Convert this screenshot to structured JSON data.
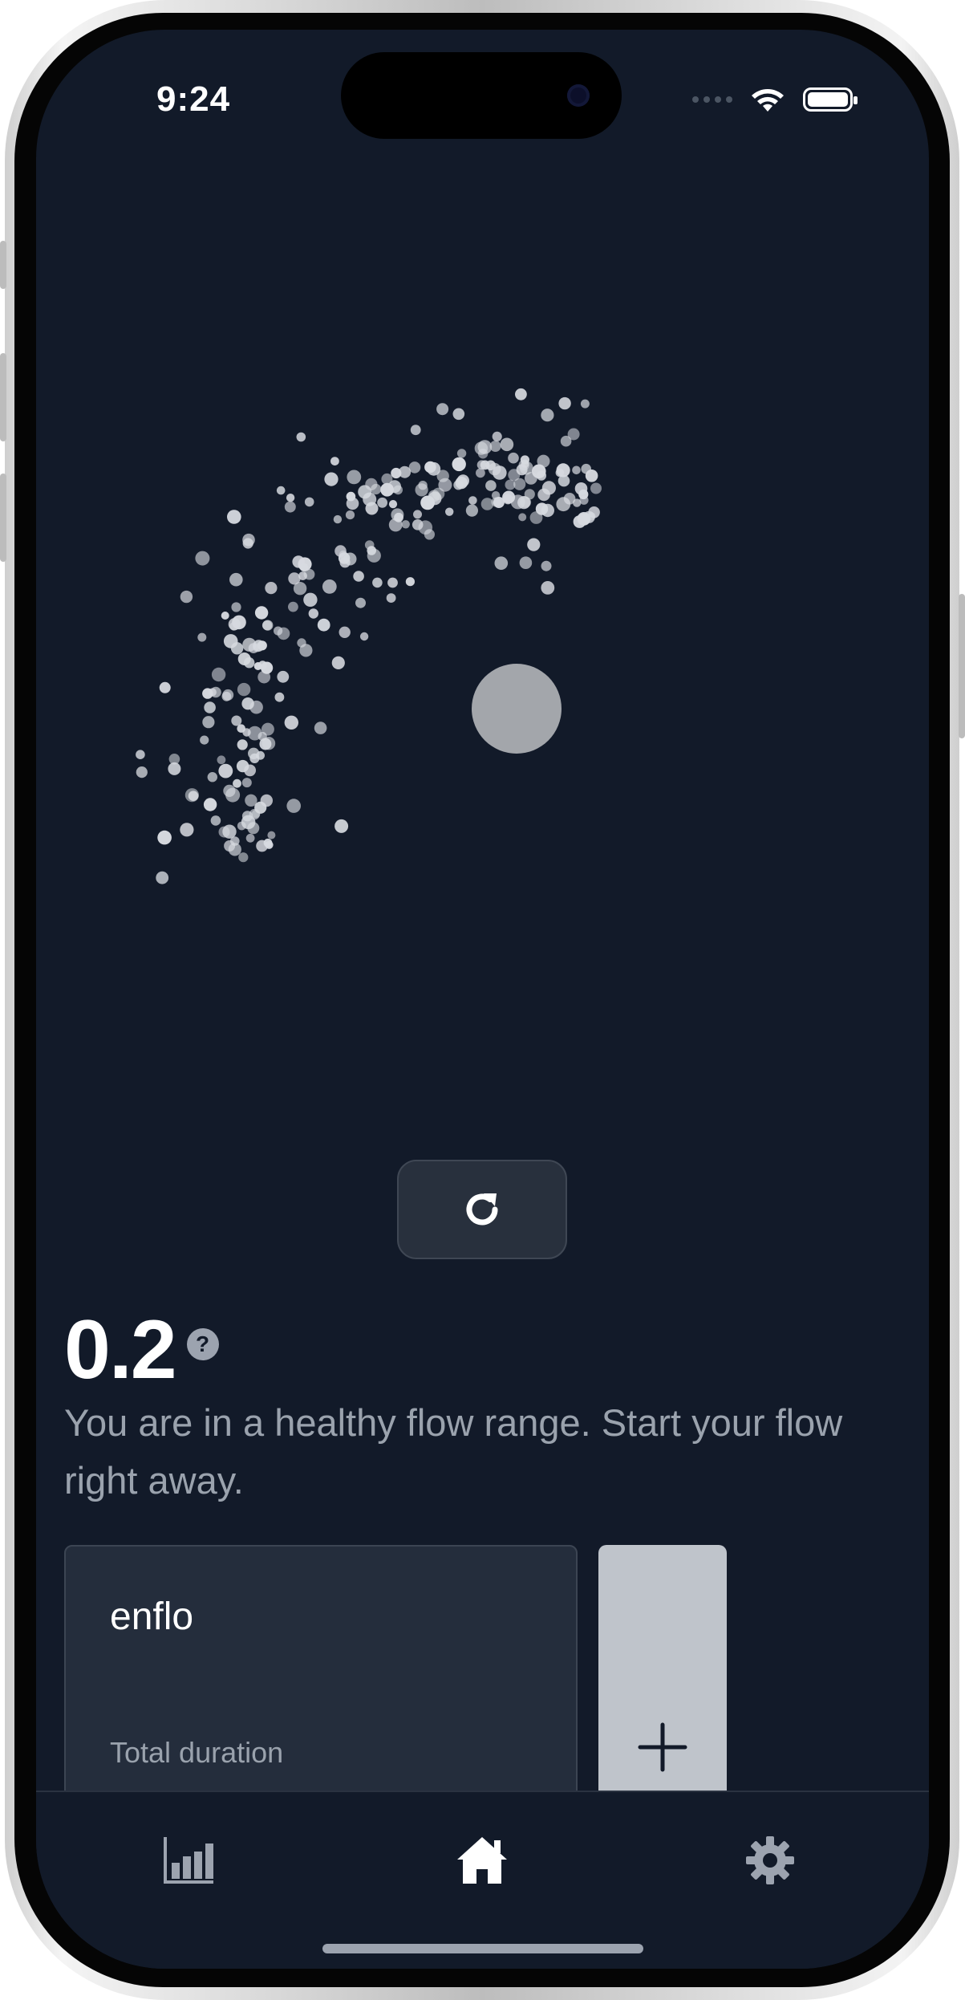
{
  "status_bar": {
    "time": "9:24"
  },
  "visual": {
    "orb_color": "#a3a6ab",
    "particle_color": "#d7dae0",
    "background": "#121a29"
  },
  "refresh_button": {
    "icon": "refresh-icon"
  },
  "flow": {
    "score": "0.2",
    "help_symbol": "?",
    "message": "You are in a healthy flow range. Start your flow right away."
  },
  "session_card": {
    "name": "enflo",
    "subtitle": "Total duration"
  },
  "add_card": {
    "icon": "plus-icon"
  },
  "tabbar": {
    "items": [
      {
        "icon": "bar-chart-icon",
        "active": false
      },
      {
        "icon": "home-icon",
        "active": true
      },
      {
        "icon": "gear-icon",
        "active": false
      }
    ]
  }
}
